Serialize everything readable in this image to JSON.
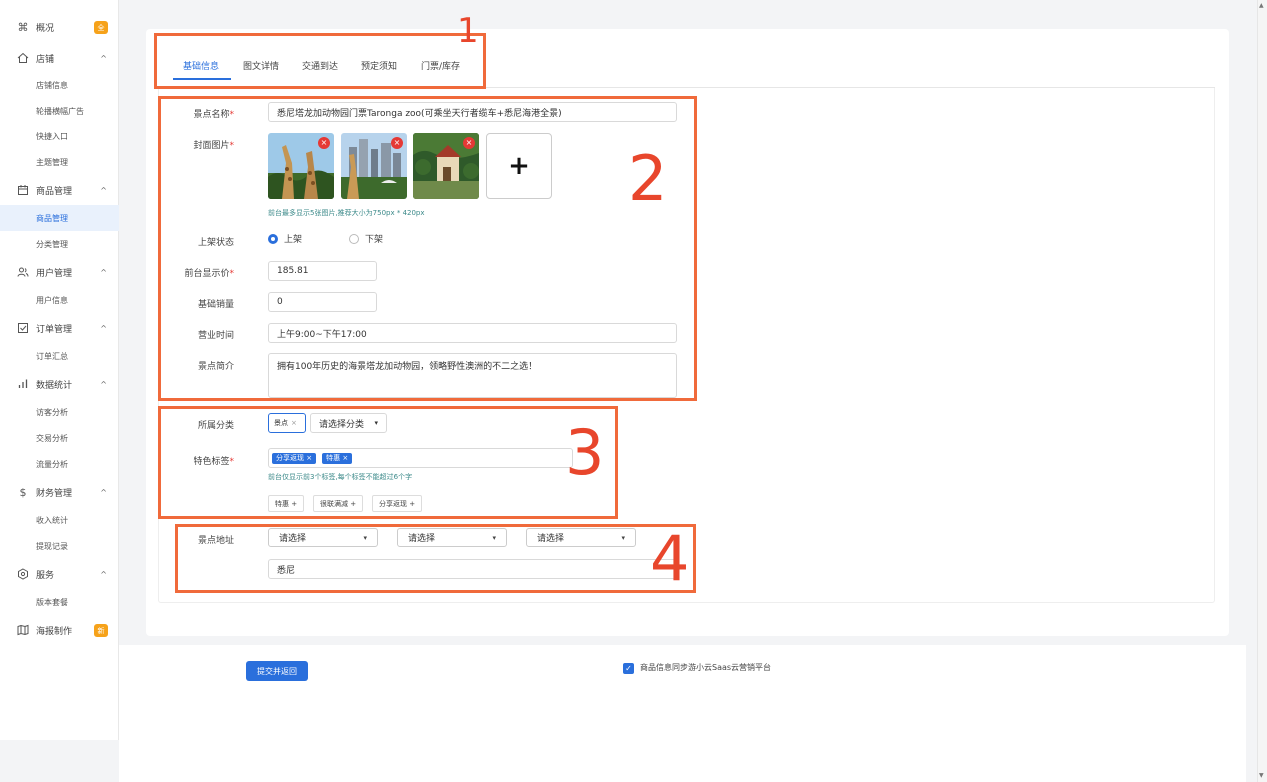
{
  "sidebar": {
    "overview": {
      "label": "概况",
      "badge": "全"
    },
    "shop": {
      "label": "店铺",
      "items": [
        "店铺信息",
        "轮播横幅广告",
        "快捷入口",
        "主题管理"
      ]
    },
    "goods": {
      "label": "商品管理",
      "items": [
        "商品管理",
        "分类管理"
      ]
    },
    "users": {
      "label": "用户管理",
      "items": [
        "用户信息"
      ]
    },
    "orders": {
      "label": "订单管理",
      "items": [
        "订单汇总"
      ]
    },
    "stats": {
      "label": "数据统计",
      "items": [
        "访客分析",
        "交易分析",
        "流量分析"
      ]
    },
    "finance": {
      "label": "财务管理",
      "items": [
        "收入统计",
        "提现记录"
      ]
    },
    "service": {
      "label": "服务",
      "items": [
        "版本套餐"
      ]
    },
    "poster": {
      "label": "海报制作",
      "badge": "新"
    },
    "chevron": "^"
  },
  "tabs": [
    "基础信息",
    "图文详情",
    "交通到达",
    "预定须知",
    "门票/库存"
  ],
  "form": {
    "name": {
      "label": "景点名称",
      "required": "*",
      "value": "悉尼塔龙加动物园门票Taronga zoo(可乘坐天行者缆车+悉尼海港全景)"
    },
    "cover": {
      "label": "封面图片",
      "required": "*",
      "add": "+",
      "delete": "×",
      "hint": "前台最多显示5张图片,推荐大小为750px * 420px"
    },
    "status": {
      "label": "上架状态",
      "on": "上架",
      "off": "下架"
    },
    "price": {
      "label": "前台显示价",
      "required": "*",
      "value": "185.81"
    },
    "sales": {
      "label": "基础销量",
      "value": "0"
    },
    "hours": {
      "label": "营业时间",
      "value": "上午9:00~下午17:00"
    },
    "intro": {
      "label": "景点简介",
      "value": "拥有100年历史的海景塔龙加动物园，领略野性澳洲的不二之选！"
    },
    "category": {
      "label": "所属分类",
      "selected": "景点",
      "remove": "×",
      "placeholder": "请选择分类",
      "arrow": "▾"
    },
    "tags": {
      "label": "特色标签",
      "required": "*",
      "selected": [
        "分享返现 ×",
        "特惠 ×"
      ],
      "hint": "前台仅显示前3个标签,每个标签不能超过6个字",
      "options": [
        "特惠 +",
        "很联满减 +",
        "分享返现 +"
      ]
    },
    "address": {
      "label": "景点地址",
      "selects": [
        "请选择",
        "请选择",
        "请选择"
      ],
      "arrow": "▾",
      "detail": "悉尼"
    }
  },
  "footer": {
    "submit": "提交并返回",
    "check": "✓",
    "sync": "商品信息同步游小云Saas云营销平台"
  },
  "annotations": [
    "1",
    "2",
    "3",
    "4"
  ],
  "scroll": {
    "up": "▲",
    "down": "▼"
  }
}
